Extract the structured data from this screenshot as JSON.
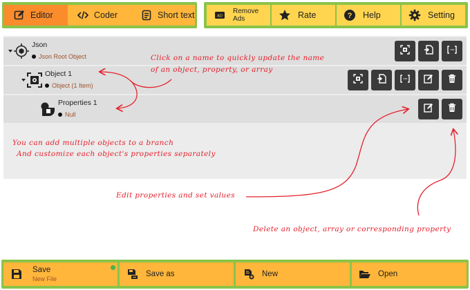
{
  "tabs": [
    {
      "label": "Editor",
      "icon": "edit-icon",
      "active": true
    },
    {
      "label": "Coder",
      "icon": "code-icon",
      "active": false
    },
    {
      "label": "Short text",
      "icon": "document-icon",
      "active": false
    }
  ],
  "actions": {
    "remove_ads": {
      "line1": "Remove",
      "line2": "Ads",
      "icon": "ads-icon"
    },
    "rate": {
      "label": "Rate",
      "icon": "star-icon"
    },
    "help": {
      "label": "Help",
      "icon": "help-icon"
    },
    "setting": {
      "label": "Setting",
      "icon": "gear-icon"
    }
  },
  "tree": {
    "root": {
      "name": "Json",
      "type": "Json Root Object"
    },
    "object1": {
      "name": "Object 1",
      "type": "Object (1 Item)"
    },
    "property1": {
      "name": "Properties 1",
      "type": "Null"
    }
  },
  "annotations": {
    "rename_line1": "Click on a name to quickly update the name",
    "rename_line2": "of an object, property, or array",
    "multi_line1": "You can add multiple objects to a branch",
    "multi_line2": "And customize each object's properties separately",
    "edit": "Edit properties and set values",
    "delete": "Delete an object, array or corresponding property"
  },
  "bottom": {
    "save": {
      "label": "Save",
      "sub": "New File",
      "icon": "save-icon"
    },
    "save_as": {
      "label": "Save as",
      "icon": "save-as-icon"
    },
    "new": {
      "label": "New",
      "icon": "new-file-icon"
    },
    "open": {
      "label": "Open",
      "icon": "folder-open-icon"
    }
  },
  "colors": {
    "accent_green": "#8bc34a",
    "tab_active": "#fb8c2c",
    "tab_inactive": "#ffb63a",
    "action_yellow": "#ffd54f",
    "annotation_red": "#e5202c",
    "button_dark": "#3a3a3a"
  }
}
